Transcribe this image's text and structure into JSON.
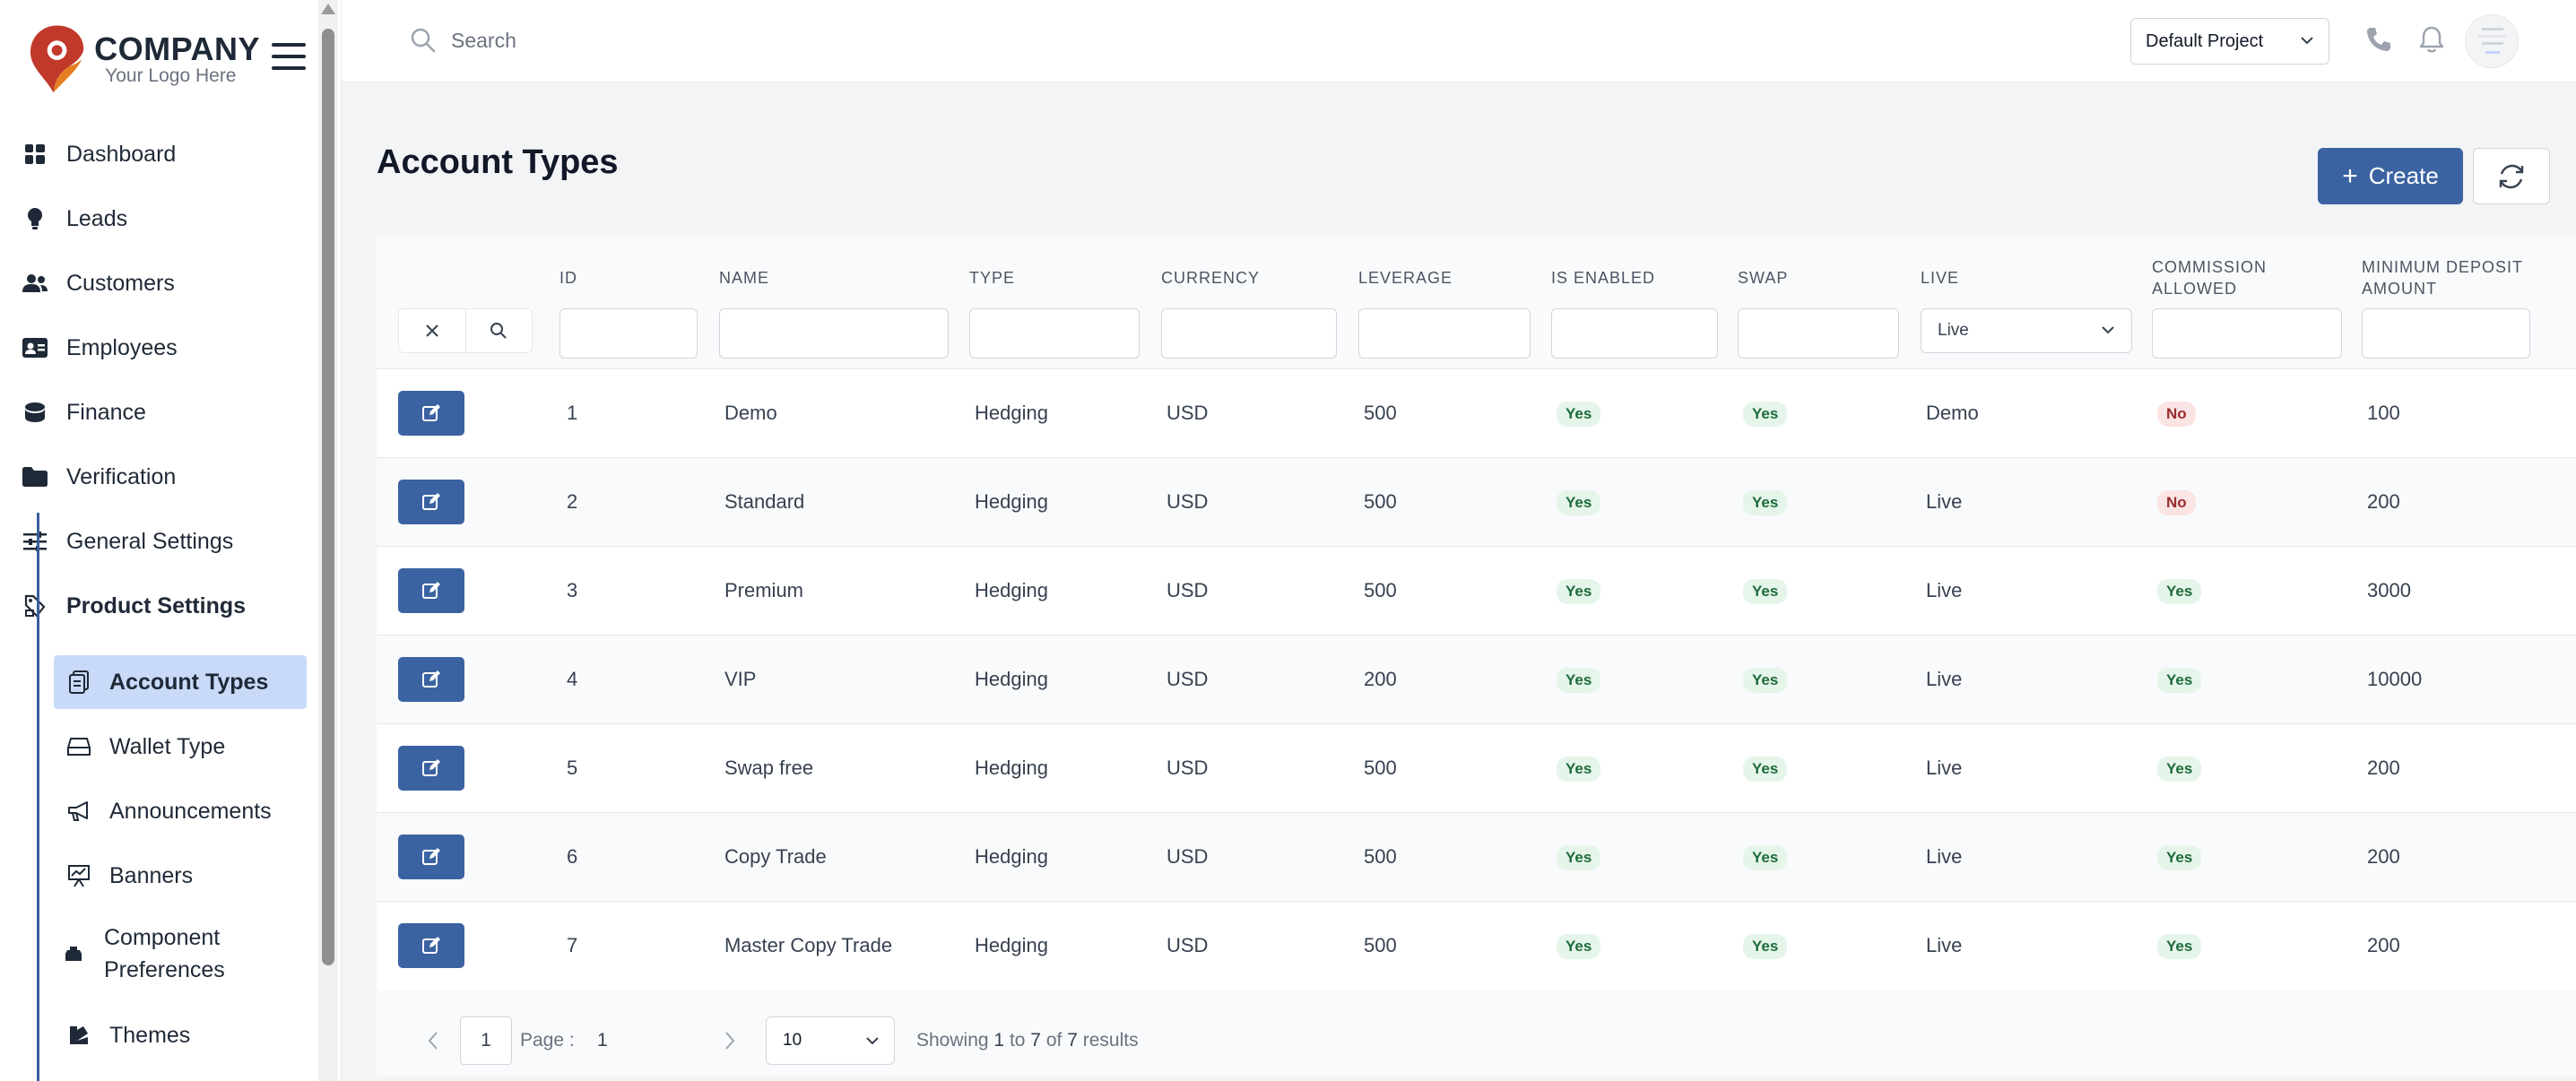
{
  "brand": {
    "company": "COMPANY",
    "tagline": "Your Logo Here",
    "colors": {
      "red": "#c0392b",
      "orange": "#e67e22",
      "accent": "#3b63a2"
    }
  },
  "sidebar": {
    "items": [
      {
        "label": "Dashboard",
        "icon": "grid-icon"
      },
      {
        "label": "Leads",
        "icon": "lightbulb-icon"
      },
      {
        "label": "Customers",
        "icon": "users-icon"
      },
      {
        "label": "Employees",
        "icon": "id-card-icon"
      },
      {
        "label": "Finance",
        "icon": "coins-icon"
      },
      {
        "label": "Verification",
        "icon": "folder-icon"
      },
      {
        "label": "General Settings",
        "icon": "sliders-icon"
      },
      {
        "label": "Product Settings",
        "icon": "product-icon"
      }
    ],
    "sub_items": [
      {
        "label": "Account Types",
        "icon": "copy-icon"
      },
      {
        "label": "Wallet Type",
        "icon": "wallet-icon"
      },
      {
        "label": "Announcements",
        "icon": "megaphone-icon"
      },
      {
        "label": "Banners",
        "icon": "presentation-icon"
      },
      {
        "label": "Component",
        "label2": "Preferences",
        "icon": "component-icon"
      },
      {
        "label": "Themes",
        "icon": "palette-icon"
      }
    ]
  },
  "header": {
    "search_placeholder": "Search",
    "project": "Default Project"
  },
  "page": {
    "title": "Account Types",
    "create_label": "Create"
  },
  "table": {
    "columns": [
      "ID",
      "NAME",
      "TYPE",
      "CURRENCY",
      "LEVERAGE",
      "IS ENABLED",
      "SWAP",
      "LIVE",
      "COMMISSION",
      "ALLOWED",
      "MINIMUM DEPOSIT",
      "AMOUNT"
    ],
    "live_filter": "Live",
    "rows": [
      {
        "id": "1",
        "name": "Demo",
        "type": "Hedging",
        "currency": "USD",
        "leverage": "500",
        "enabled": "Yes",
        "swap": "Yes",
        "live": "Demo",
        "commission": "No",
        "min_deposit": "100"
      },
      {
        "id": "2",
        "name": "Standard",
        "type": "Hedging",
        "currency": "USD",
        "leverage": "500",
        "enabled": "Yes",
        "swap": "Yes",
        "live": "Live",
        "commission": "No",
        "min_deposit": "200"
      },
      {
        "id": "3",
        "name": "Premium",
        "type": "Hedging",
        "currency": "USD",
        "leverage": "500",
        "enabled": "Yes",
        "swap": "Yes",
        "live": "Live",
        "commission": "Yes",
        "min_deposit": "3000"
      },
      {
        "id": "4",
        "name": "VIP",
        "type": "Hedging",
        "currency": "USD",
        "leverage": "200",
        "enabled": "Yes",
        "swap": "Yes",
        "live": "Live",
        "commission": "Yes",
        "min_deposit": "10000"
      },
      {
        "id": "5",
        "name": "Swap free",
        "type": "Hedging",
        "currency": "USD",
        "leverage": "500",
        "enabled": "Yes",
        "swap": "Yes",
        "live": "Live",
        "commission": "Yes",
        "min_deposit": "200"
      },
      {
        "id": "6",
        "name": "Copy Trade",
        "type": "Hedging",
        "currency": "USD",
        "leverage": "500",
        "enabled": "Yes",
        "swap": "Yes",
        "live": "Live",
        "commission": "Yes",
        "min_deposit": "200"
      },
      {
        "id": "7",
        "name": "Master Copy Trade",
        "type": "Hedging",
        "currency": "USD",
        "leverage": "500",
        "enabled": "Yes",
        "swap": "Yes",
        "live": "Live",
        "commission": "Yes",
        "min_deposit": "200"
      }
    ]
  },
  "pagination": {
    "current": "1",
    "page_label": "Page :",
    "page_num": "1",
    "page_size": "10",
    "showing": "Showing",
    "from": "1",
    "to_word": "to",
    "to": "7",
    "of_word": "of",
    "total": "7",
    "results_word": "results"
  }
}
